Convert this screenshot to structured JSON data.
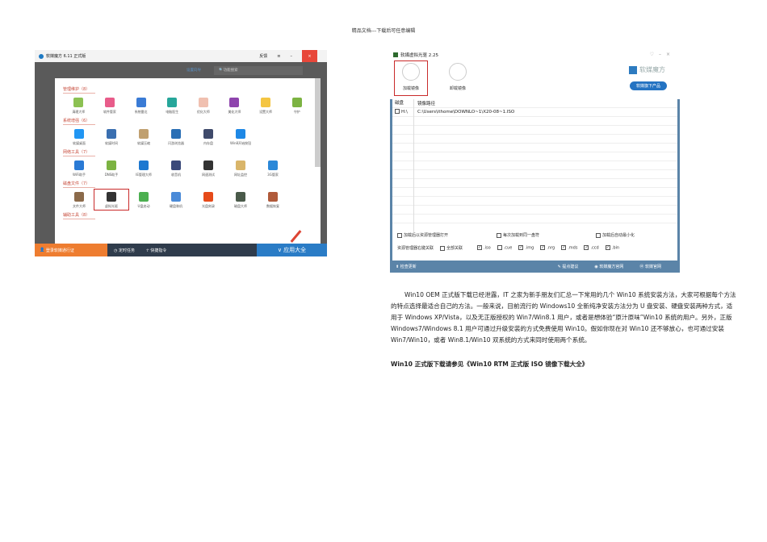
{
  "header": "精品文档---下载后可任意编辑",
  "left_app": {
    "title": "软媒魔方 6.11 正式版",
    "feedback": "反馈",
    "menu_icon": "≡",
    "minimize": "–",
    "close": "×",
    "wizard": "设置向导",
    "search_placeholder": "功能搜索",
    "sections": [
      {
        "title": "管理维护（8）",
        "items": [
          {
            "label": "清理大师",
            "color": "#8cc152"
          },
          {
            "label": "软件管家",
            "color": "#e85c8a"
          },
          {
            "label": "系统雷达",
            "color": "#3a7bd5"
          },
          {
            "label": "电脑医生",
            "color": "#26a69a"
          },
          {
            "label": "优化大师",
            "color": "#f0c0b0"
          },
          {
            "label": "美化大师",
            "color": "#8e44ad"
          },
          {
            "label": "设置大师",
            "color": "#f4c542"
          },
          {
            "label": "守护",
            "color": "#7cb342"
          }
        ]
      },
      {
        "title": "系统增强（6）",
        "items": [
          {
            "label": "软媒桌面",
            "color": "#2196f3"
          },
          {
            "label": "软媒时间",
            "color": "#3a6fb0"
          },
          {
            "label": "软媒压缩",
            "color": "#c0a070"
          },
          {
            "label": "闪游浏览器",
            "color": "#2a6fb5"
          },
          {
            "label": "内存盘",
            "color": "#3f4a6b"
          },
          {
            "label": "Win8开始按钮",
            "color": "#1e88e5"
          }
        ]
      },
      {
        "title": "网络工具（7）",
        "items": [
          {
            "label": "WiFi助手",
            "color": "#2a7ad5"
          },
          {
            "label": "DNS助手",
            "color": "#7cb342"
          },
          {
            "label": "IE管理大师",
            "color": "#1e78d0"
          },
          {
            "label": "收音机",
            "color": "#3b4a7a"
          },
          {
            "label": "网速测试",
            "color": "#333"
          },
          {
            "label": "网址监控",
            "color": "#d9b56a"
          },
          {
            "label": "3G管家",
            "color": "#2b88d8"
          }
        ]
      },
      {
        "title": "磁盘文件（7）",
        "items": [
          {
            "label": "文件大师",
            "color": "#8b6a4a"
          },
          {
            "label": "虚拟光驱",
            "color": "#333",
            "selected": true
          },
          {
            "label": "U盘启动",
            "color": "#4caf50"
          },
          {
            "label": "硬盘装机",
            "color": "#4a8ad8"
          },
          {
            "label": "光盘刻录",
            "color": "#e64a19"
          },
          {
            "label": "磁盘大师",
            "color": "#4a5a4a"
          },
          {
            "label": "数据恢复",
            "color": "#b05a3a"
          }
        ]
      },
      {
        "title": "辅助工具（8）",
        "items": []
      }
    ],
    "bottom": {
      "login": "登录软媒通行证",
      "timer": "定时任务",
      "shortcut": "快捷指令",
      "apps": "应用大全"
    }
  },
  "right_app": {
    "title": "软媒虚拟光驱 2.25",
    "load": "加载镜像",
    "unload": "卸载镜像",
    "brand": "软媒魔方",
    "products": "软媒旗下产品",
    "columns": [
      "磁盘",
      "镜像路径"
    ],
    "rows": [
      {
        "drive": "H:\\",
        "path": "C:\\Users\\ithome\\DOWNLO~1\\X20-08~1.ISO"
      }
    ],
    "options": [
      "加载后以资源管理器打开",
      "每次加载到同一盘符",
      "加载后自动最小化"
    ],
    "assoc_label": "资源管理器右键关联",
    "assoc_all": "全部关联",
    "exts": [
      {
        "ext": ".iso",
        "checked": true
      },
      {
        "ext": ".cue",
        "checked": false
      },
      {
        "ext": ".img",
        "checked": true
      },
      {
        "ext": ".nrg",
        "checked": true
      },
      {
        "ext": ".mds",
        "checked": true
      },
      {
        "ext": ".ccd",
        "checked": true
      },
      {
        "ext": ".bin",
        "checked": true
      }
    ],
    "footer": {
      "update": "检查更新",
      "suggest": "提点建议",
      "site1": "软媒魔方官网",
      "site2": "软媒官网"
    }
  },
  "body": {
    "paragraph": "Win10 OEM 正式版下载已经泄露，IT 之家为新手朋友们汇总一下常用的几个 Win10 系统安装方法，大家可根据每个方法的特点选择最适合自己的方法。一般来说，目前流行的 Windows10 全新纯净安装方法分为 U 盘安装、硬盘安装两种方式，适用于 Windows XP/Vista，以及无正版授权的 Win7/Win8.1 用户，或者是想体验“原汁原味”Win10 系统的用户。另外，正版 Windows7/Windows 8.1 用户可通过升级安装的方式免费使用 Win10。假如你现在对 Win10 还不够放心，也可通过安装 Win7/Win10，或者 Win8.1/Win10 双系统的方式来同时使用两个系统。",
    "link": "Win10 正式版下载请参见《Win10 RTM 正式版 ISO 镜像下载大全》"
  }
}
